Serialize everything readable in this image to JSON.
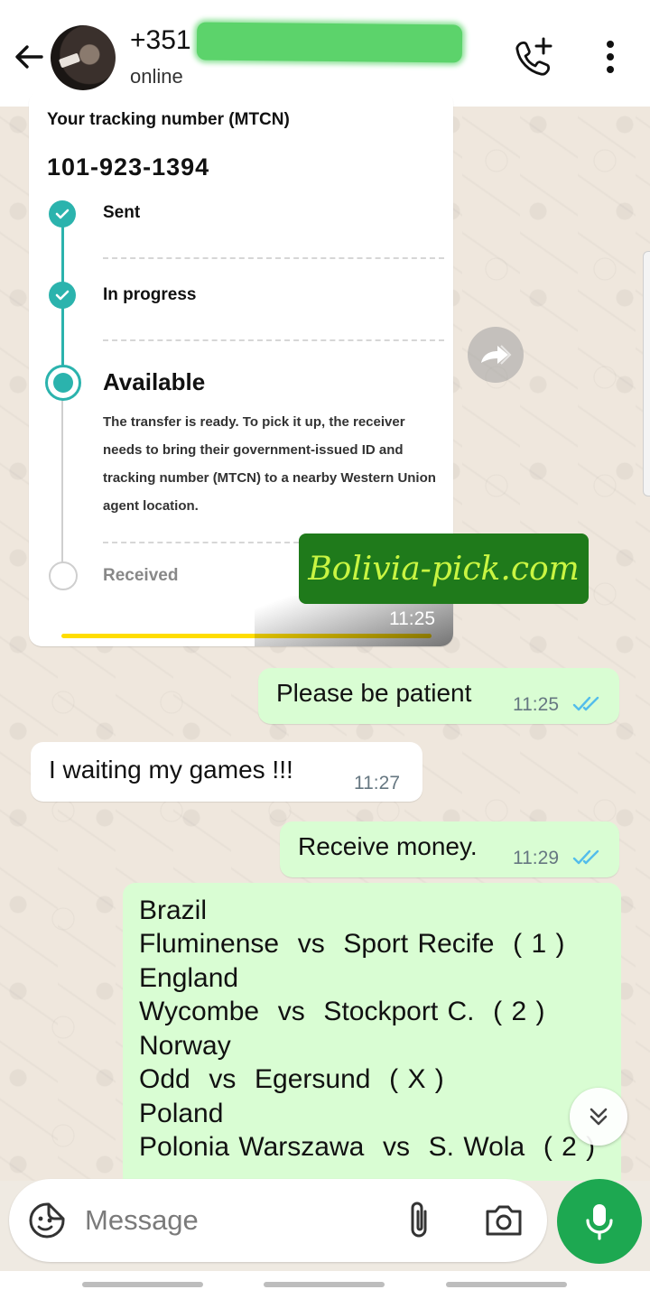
{
  "header": {
    "contact_name": "+351",
    "status": "online",
    "icons": [
      "back-arrow-icon",
      "add-call-icon",
      "more-vert-icon"
    ]
  },
  "image_message": {
    "tracking_label": "Your tracking number (MTCN)",
    "tracking_number": "101-923-1394",
    "steps": [
      {
        "label": "Sent",
        "state": "done"
      },
      {
        "label": "In progress",
        "state": "done"
      },
      {
        "label": "Available",
        "state": "current"
      },
      {
        "label": "Received",
        "state": "pending"
      }
    ],
    "available_description": "The transfer is ready. To pick it up, the receiver needs to bring their government-issued ID and tracking number (MTCN) to a nearby Western Union agent location.",
    "time": "11:25"
  },
  "watermark": "Bolivia-pick.com",
  "messages": [
    {
      "direction": "out",
      "text": "Please be patient",
      "time": "11:25",
      "read": true
    },
    {
      "direction": "in",
      "text": "I waiting my games !!!",
      "time": "11:27"
    },
    {
      "direction": "out",
      "text": "Receive money.",
      "time": "11:29",
      "read": true
    }
  ],
  "picks_message": {
    "lines": [
      "Brazil",
      "Fluminense  vs  Sport Recife  ( 1 )",
      "England",
      "Wycombe  vs  Stockport C.  ( 2 )",
      "Norway",
      "Odd  vs  Egersund  ( X )",
      "Poland",
      "Polonia Warszawa  vs  S. Wola  ( 2 )"
    ]
  },
  "composer": {
    "placeholder": "Message"
  },
  "colors": {
    "outgoing_bubble": "#d9fdd3",
    "incoming_bubble": "#ffffff",
    "read_ticks": "#53bdeb",
    "accent_green": "#1da851",
    "tracker_teal": "#2bb3ad"
  }
}
